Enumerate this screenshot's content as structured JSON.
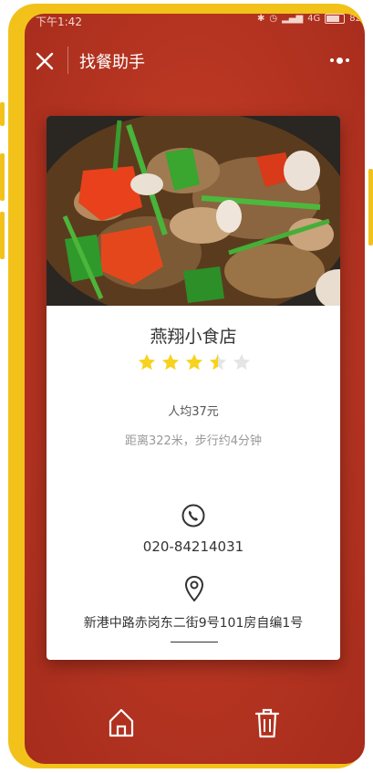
{
  "status_bar": {
    "time": "下午1:42",
    "network": "4G",
    "battery": "82"
  },
  "nav": {
    "title": "找餐助手",
    "close_icon": "close-icon",
    "more_icon": "more-dots-icon"
  },
  "restaurant": {
    "name": "燕翔小食店",
    "rating": 3.5,
    "rating_max": 5,
    "avg_price": "人均37元",
    "distance": "距离322米，步行约4分钟",
    "phone": "020-84214031",
    "address": "新港中路赤岗东二街9号101房自编1号"
  },
  "bottom_bar": {
    "home_icon": "home-icon",
    "delete_icon": "trash-icon"
  },
  "colors": {
    "frame": "#f2c21a",
    "background": "#b53421",
    "star_filled": "#f7d21e",
    "star_empty": "#e5e5e5"
  }
}
